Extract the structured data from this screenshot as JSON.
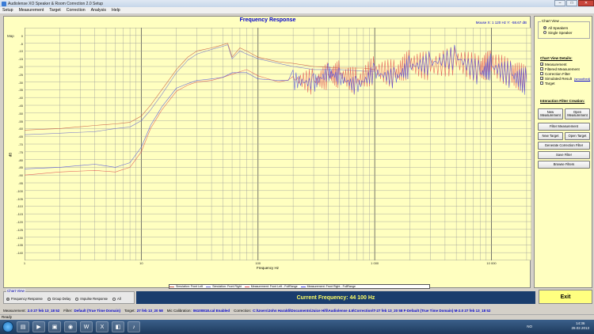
{
  "window": {
    "title": "Audiolense XO Speaker & Room Correction 2.0 Setup",
    "btn_min": "–",
    "btn_max": "□",
    "btn_close": "✕"
  },
  "menu": [
    "Setup",
    "Measurement",
    "Target",
    "Correction",
    "Analysis",
    "Help"
  ],
  "chart": {
    "map_tab": "Map",
    "mv_tab": "Mv",
    "mouse_readout": "Mouse X: 1 120 Hz  Y: -58.67 dB"
  },
  "chart_data": {
    "type": "line",
    "title": "Frequency Response",
    "xlabel": "Frequency Hz",
    "ylabel": "dB",
    "xscale": "log",
    "xlim": [
      1,
      22000
    ],
    "ylim": [
      -145,
      5
    ],
    "grid": true,
    "legend_position": "bottom-center",
    "yticks": [
      "0",
      "-5",
      "-10",
      "-15",
      "-20",
      "-25",
      "-30",
      "-35",
      "-40",
      "-45",
      "-50",
      "-55",
      "-60",
      "-65",
      "-70",
      "-75",
      "-80",
      "-85",
      "-90",
      "-95",
      "-100",
      "-105",
      "-110",
      "-115",
      "-120",
      "-125",
      "-130",
      "-135",
      "-140"
    ],
    "xticks": [
      {
        "v": 1,
        "label": "1"
      },
      {
        "v": 10,
        "label": "10"
      },
      {
        "v": 100,
        "label": "100"
      },
      {
        "v": 1000,
        "label": "1 000"
      },
      {
        "v": 10000,
        "label": "10 000"
      }
    ],
    "series": [
      {
        "name": "Simulation: Front Left",
        "color": "#c8553d",
        "x": [
          1,
          2,
          4,
          6,
          8,
          10,
          12,
          15,
          20,
          25,
          30,
          40,
          50,
          55,
          60,
          70,
          80,
          100,
          150,
          200,
          300,
          500,
          800,
          1000
        ],
        "y": [
          -61,
          -60,
          -58,
          -57,
          -56,
          -52,
          -45,
          -35,
          -22,
          -14,
          -10,
          -8,
          -6,
          -5,
          -14,
          -8,
          -10,
          -14,
          -17,
          -18,
          -20,
          -21,
          -21,
          -22
        ]
      },
      {
        "name": "Simulation: Front Right",
        "color": "#6c6ccc",
        "x": [
          1,
          2,
          4,
          6,
          8,
          10,
          12,
          15,
          20,
          25,
          30,
          40,
          50,
          55,
          60,
          70,
          80,
          100,
          150,
          200,
          300,
          500,
          800,
          1000
        ],
        "y": [
          -64,
          -63,
          -62,
          -60,
          -59,
          -55,
          -48,
          -38,
          -24,
          -16,
          -12,
          -9,
          -7,
          -6,
          -15,
          -10,
          -12,
          -15,
          -18,
          -20,
          -22,
          -22,
          -23,
          -23
        ]
      },
      {
        "name": "Measurement: Front Left - FullRange",
        "color": "#e05050",
        "x": [
          1,
          2,
          4,
          6,
          8,
          10,
          12,
          15,
          20,
          25,
          30,
          40,
          50,
          60,
          80,
          100,
          150,
          200,
          300,
          400,
          500,
          700,
          1000,
          1500,
          2000,
          3000,
          5000,
          8000,
          10000,
          15000,
          20000
        ],
        "y": [
          -90,
          -88,
          -87,
          -88,
          -85,
          -75,
          -60,
          -48,
          -36,
          -32,
          -30,
          -29,
          -27,
          -25,
          -22,
          -26,
          -30,
          -28,
          -30,
          -26,
          -25,
          -30,
          -22,
          -25,
          -18,
          -20,
          -16,
          -22,
          -18,
          -25,
          -28
        ]
      },
      {
        "name": "Measurement: Front Right - FullRange",
        "color": "#4a4ae0",
        "x": [
          1,
          2,
          4,
          6,
          8,
          10,
          12,
          15,
          20,
          25,
          30,
          40,
          50,
          60,
          80,
          100,
          150,
          200,
          300,
          400,
          500,
          700,
          1000,
          1500,
          2000,
          3000,
          5000,
          8000,
          10000,
          15000,
          20000
        ],
        "y": [
          -86,
          -85,
          -83,
          -85,
          -82,
          -72,
          -58,
          -46,
          -34,
          -31,
          -29,
          -28,
          -27,
          -24,
          -24,
          -28,
          -29,
          -29,
          -31,
          -24,
          -27,
          -33,
          -24,
          -28,
          -20,
          -18,
          -14,
          -25,
          -20,
          -26,
          -30
        ]
      }
    ]
  },
  "side": {
    "chart_view_title": "Chart View",
    "view_all": "All Speakers",
    "view_single": "Single Speaker",
    "details_title": "Chart View Details:",
    "details": [
      {
        "label": "Measurement",
        "checked": true
      },
      {
        "label": "Filtered Measurement",
        "checked": false
      },
      {
        "label": "Correction Filter",
        "checked": false
      },
      {
        "label": "Simulated Result",
        "checked": true,
        "link": "(smoothed)"
      },
      {
        "label": "Target",
        "checked": false
      }
    ],
    "interaction_title": "Interaction Filter Creation:",
    "new_measurement": "New Measurement",
    "open_measurement": "Open Measurement",
    "filter_measurement": "Filter Measurement",
    "new_target": "New Target",
    "open_target": "Open Target",
    "generate_correction": "Generate Correction Filter",
    "save_filter": "Save Filter",
    "browse_filters": "Browse Filters"
  },
  "bottom": {
    "chart_view_title": "Chart View",
    "options": [
      "Frequency Response",
      "Group Delay",
      "Impulse Response",
      "All"
    ],
    "current_frequency": "Current Frequency: 44 100 Hz",
    "exit": "Exit"
  },
  "info": {
    "measurement_k": "Measurement:",
    "measurement_v": "2.0 27 feb 13_18 52",
    "filter_k": "Filter:",
    "filter_v": "Default (True Time Domain)",
    "target_k": "Target:",
    "target_v": "27 feb 13_20 58",
    "mic_k": "Mic Calibration:",
    "mic_v": "06100818.cal Enabled",
    "correction_k": "Correction:",
    "correction_v": "C:\\Users\\John Haraldi\\Documents\\Juice Hifi\\Audiolense 4.6\\Correction\\T-27 feb 13_20 58 F-Default (True Time Domain) M-2.0 27 feb 13_18 52"
  },
  "status": "Ready",
  "taskbar": {
    "lang": "NO",
    "time": "14:36",
    "date": "28.02.2013"
  }
}
